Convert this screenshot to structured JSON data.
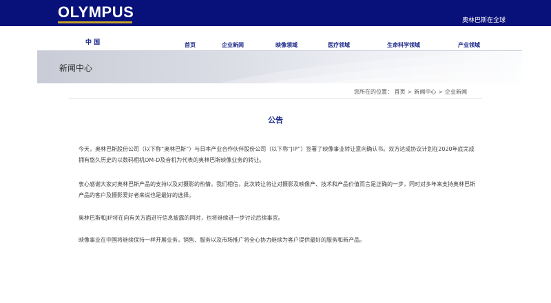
{
  "header": {
    "logo_text": "OLYMPUS",
    "global_link": "奥林巴斯在全球",
    "colors": {
      "bar": "#08107a",
      "logo_underline": "#c9a227"
    }
  },
  "nav": {
    "region": "中 国",
    "items": [
      {
        "label": "首页"
      },
      {
        "label": "企业新闻"
      },
      {
        "label": "映像领域"
      },
      {
        "label": "医疗领域"
      },
      {
        "label": "生命科学领域"
      },
      {
        "label": "产业领域"
      }
    ]
  },
  "banner": {
    "title": "新闻中心"
  },
  "breadcrumb": {
    "prefix": "您所在的位置：",
    "items": [
      "首页",
      "新闻中心",
      "企业新闻"
    ],
    "separator": ">"
  },
  "article": {
    "title": "公告",
    "paragraphs": [
      "今天，奥林巴斯股份公司（以下称“奥林巴斯”）与日本产业合作伙伴股份公司（以下称“JIP”）签署了映像事业转让意向确认书。双方达成协议计划在2020年底完成拥有悠久历史的以数码相机OM-D及音机为代表的奥林巴斯映像业务的转让。",
      "衷心感谢大家对奥林巴斯产品的支持以及对摄影的热情。我们相信，此次转让将让对摄影及映像产、技术和产品价值而言是正确的一步，同时对多年来支持奥林巴斯产品的客户及摄影爱好者来说也是最好的选择。",
      "奥林巴斯和JIP将在向有关方面进行信息披露的同时，也将继续进一步讨论后续事宜。",
      "映像事业在中国将继续保持一样开展业务，销售、服务以及市场推广将全心协力继续为客户提供最好的服务和新产品。"
    ]
  }
}
